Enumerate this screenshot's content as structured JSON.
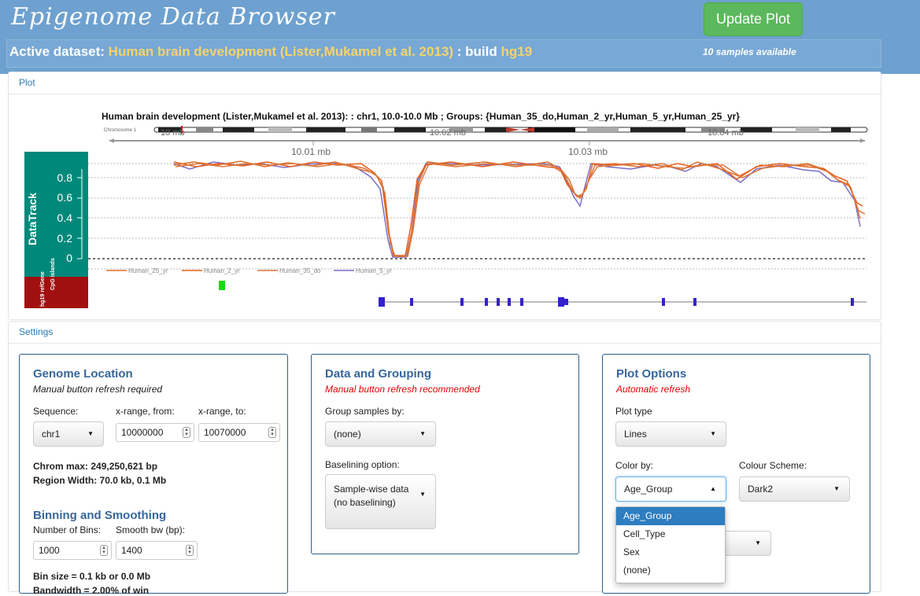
{
  "app": {
    "title": "Epigenome Data Browser"
  },
  "header": {
    "update_button": "Update Plot",
    "dataset_prefix": "Active dataset:",
    "dataset_name": "Human brain development (Lister,Mukamel et al. 2013)",
    "build_prefix": ": build",
    "build": "hg19",
    "samples_available": "10 samples available"
  },
  "plot_panel": {
    "title": "Plot",
    "plot_title": "Human brain development (Lister,Mukamel et al. 2013): : chr1, 10.0-10.0 Mb ; Groups: {Human_35_do,Human_2_yr,Human_5_yr,Human_25_yr}",
    "ideogram_label": "Chromosome 1",
    "ideogram_ticks": [
      "10 mb",
      "10.02 mb",
      "10.04 mb"
    ],
    "axis_ticks": [
      "10.01 mb",
      "10.03 mb"
    ],
    "track_label": "DataTrack",
    "y_ticks": [
      "0.8",
      "0.6",
      "0.4",
      "0.2",
      "0"
    ],
    "legend": [
      "Human_25_yr",
      "Human_2_yr",
      "Human_35_do",
      "Human_5_yr"
    ],
    "cpg_label": "CpG islands",
    "genes_label": "hg19 refGene",
    "series_colors": [
      "#e0702a",
      "#e8601c",
      "#d9773c",
      "#7b6fc8"
    ],
    "chart_data": {
      "type": "line",
      "x_range_mb": [
        10.0,
        10.07
      ],
      "ylim": [
        0,
        1
      ],
      "series": [
        {
          "name": "Human_25_yr"
        },
        {
          "name": "Human_2_yr"
        },
        {
          "name": "Human_35_do"
        },
        {
          "name": "Human_5_yr"
        }
      ]
    }
  },
  "settings": {
    "title": "Settings",
    "genome": {
      "title": "Genome Location",
      "subtitle": "Manual button refresh required",
      "sequence_label": "Sequence:",
      "sequence_value": "chr1",
      "from_label": "x-range, from:",
      "from_value": "10000000",
      "to_label": "x-range, to:",
      "to_value": "10070000",
      "chrom_max": "Chrom max: 249,250,621 bp",
      "region_width": "Region Width: 70.0 kb, 0.1 Mb"
    },
    "binning": {
      "title": "Binning and Smoothing",
      "bins_label": "Number of Bins:",
      "bins_value": "1000",
      "smooth_label": "Smooth bw (bp):",
      "smooth_value": "1400",
      "bin_size": "Bin size = 0.1 kb or 0.0 Mb",
      "bandwidth": "Bandwidth = 2.00% of win"
    },
    "data": {
      "title": "Data and Grouping",
      "subtitle": "Manual button refresh recommended",
      "group_label": "Group samples by:",
      "group_value": "(none)",
      "baseline_label": "Baselining option:",
      "baseline_value_1": "Sample-wise data",
      "baseline_value_2": "(no baselining)"
    },
    "plot_options": {
      "title": "Plot Options",
      "subtitle": "Automatic refresh",
      "plot_type_label": "Plot type",
      "plot_type_value": "Lines",
      "color_by_label": "Color by:",
      "color_by_value": "Age_Group",
      "scheme_label": "Colour Scheme:",
      "scheme_value": "Dark2",
      "options": [
        "Age_Group",
        "Cell_Type",
        "Sex",
        "(none)"
      ]
    }
  }
}
